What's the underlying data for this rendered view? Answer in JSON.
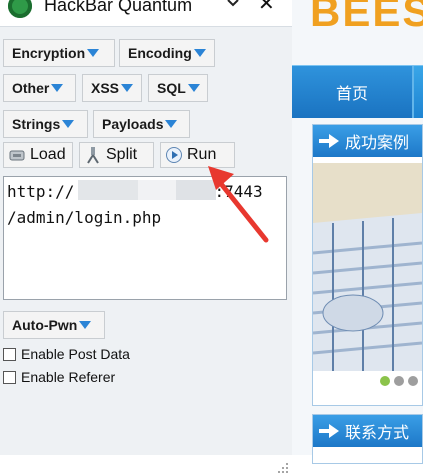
{
  "hackbar": {
    "title": "HackBar Quantum",
    "close_symbol": "✕",
    "menus": {
      "encryption": "Encryption",
      "encoding": "Encoding",
      "other": "Other",
      "xss": "XSS",
      "sql": "SQL",
      "strings": "Strings",
      "payloads": "Payloads",
      "autopwn": "Auto-Pwn"
    },
    "tools": {
      "load": "Load",
      "split": "Split",
      "run": "Run"
    },
    "url_line1": "http://",
    "url_line1_tail": ":7443",
    "url_line2": "/admin/login.php",
    "checkboxes": {
      "post_data": "Enable Post Data",
      "referer": "Enable Referer"
    }
  },
  "site": {
    "logo": "BEES",
    "nav_home": "首页",
    "box1_title": "成功案例",
    "box2_title": "联系方式"
  },
  "colors": {
    "accent_blue": "#2b84d6",
    "annotation_red": "#e8382f"
  }
}
